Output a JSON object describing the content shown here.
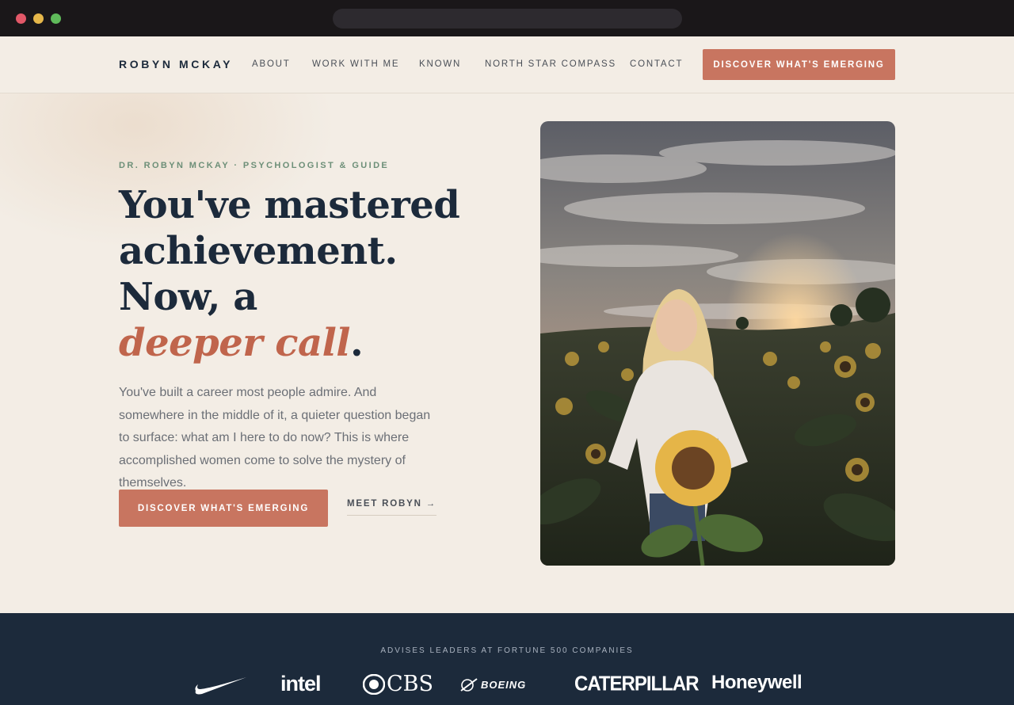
{
  "nav": {
    "brand": "ROBYN MCKAY",
    "links": [
      "ABOUT",
      "WORK WITH ME",
      "KNOWN",
      "NORTH STAR COMPASS",
      "CONTACT"
    ],
    "cta": "DISCOVER WHAT'S EMERGING"
  },
  "hero": {
    "eyebrow": "DR. ROBYN MCKAY · PSYCHOLOGIST & GUIDE",
    "headline_lines": [
      "You've mastered",
      "achievement.",
      "Now, a"
    ],
    "headline_accent": "deeper call",
    "headline_end": ".",
    "lede": "You've built a career most people admire. And somewhere in the middle of it, a quieter question began to surface: what am I here to do now? This is where accomplished women come to solve the mystery of themselves.",
    "primary_cta": "DISCOVER WHAT'S EMERGING",
    "secondary_cta": "MEET ROBYN →",
    "photo_icon": "woman-in-sunflower-field-photo"
  },
  "clients": {
    "label": "ADVISES LEADERS AT FORTUNE 500 COMPANIES",
    "logos": [
      "nike-swoosh-logo",
      "intel",
      "CBS",
      "BOEING",
      "CATERPILLAR",
      "Honeywell"
    ]
  },
  "colors": {
    "accent": "#c87560",
    "navy": "#1c2a3b",
    "background": "#f3ede5",
    "eyebrow_green": "#6d8f78"
  }
}
